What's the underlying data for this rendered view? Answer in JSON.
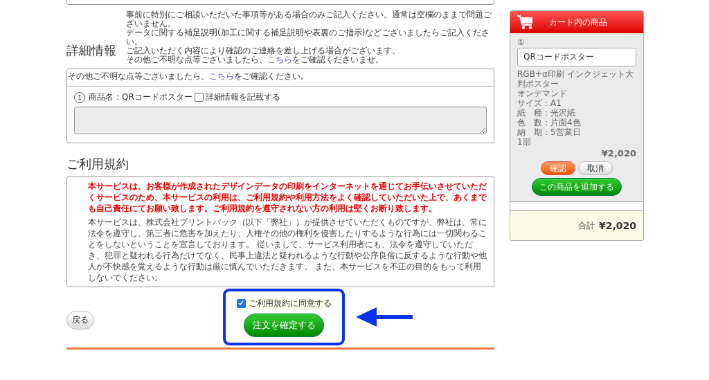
{
  "details": {
    "heading": "詳細情報",
    "notes": [
      {
        "text": "事前に特別にご相談いただいた事項等がある場合のみご記入ください。通常は空欄のままで問題ございません。"
      },
      {
        "text": "データに関する補足説明(加工に関する補足説明や表裏のご指示)などございましたらご記入ください。"
      },
      {
        "text": "ご記入いただく内容により確認のご連絡を差し上げる場合がございます。"
      },
      {
        "before": "その他ご不明な点等ございましたら、",
        "link": "こちら",
        "after": "をご確認くださいませ。"
      }
    ],
    "box_intro": {
      "before": "その他ご不明な点等ございましたら、",
      "link": "こちら",
      "after": "をご確認ください。"
    },
    "items": [
      {
        "number": "1",
        "product": "商品名：QRコードポスター",
        "checkbox_label": "詳細情報を記載する",
        "checked": false
      }
    ]
  },
  "terms": {
    "heading": "ご利用規約",
    "warning": "本サービスは、お客様が作成されたデザインデータの印刷をインターネットを通じてお手伝いさせていただくサービスのため、本サービスの利用は、ご利用規約や利用方法をよく確認していただいた上で、あくまでも自己責任にてお願い致します。ご利用規約を遵守されない方の利用は堅くお断り致します。",
    "body": "本サービスは、株式会社プリントパック（以下「弊社」）が提供させていただくものですが、弊社は、常に法令を遵守し、第三者に危害を加えたり、人権その他の権利を侵害したりするような行為には一切関わることをしないということを宣言しております。 従いまして、サービス利用者にも、法令を遵守していただき、犯罪と疑われる行為だけでなく、民事上違法と疑われるような行動や公序良俗に反するような行動や他人が不快感を覚えるような行動は厳に慎んでいただきます。 また、本サービスを不正の目的をもって利用しないでください。"
  },
  "footer": {
    "back_button": "戻る",
    "agree": {
      "label": "ご利用規約に同意する",
      "checked": true
    },
    "confirm_button": "注文を確定する"
  },
  "cart": {
    "title": "カート内の商品",
    "items": [
      {
        "number": "①",
        "name": "QRコードポスター",
        "specs": [
          "RGB+α印刷 インクジェット大判ポスター",
          "オンデマンド",
          "サイズ：A1",
          "紙　種：光沢紙",
          "色　数：片面4色",
          "納　期：5営業日",
          "1部"
        ],
        "price": "¥2,020"
      }
    ],
    "confirm_button": "確認",
    "cancel_button": "取消",
    "add_button": "この商品を追加する",
    "total_label": "合計",
    "total": "¥2,020"
  }
}
